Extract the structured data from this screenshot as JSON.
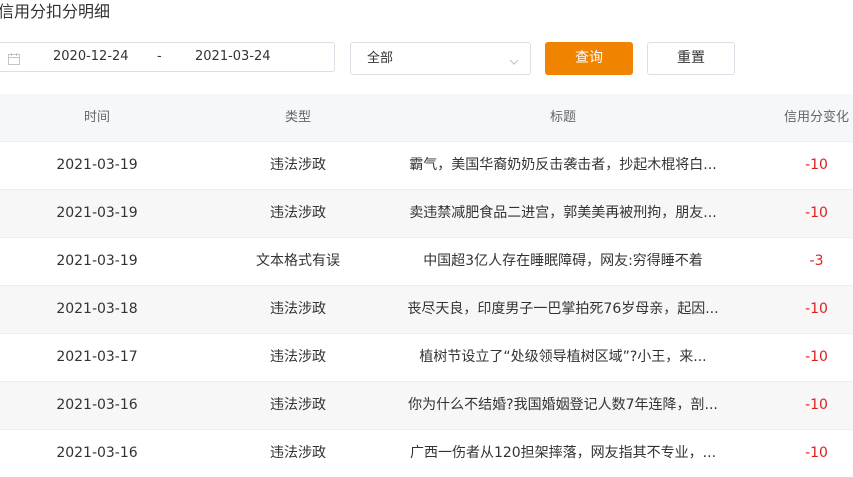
{
  "page": {
    "title": "信用分扣分明细"
  },
  "filters": {
    "date_start": "2020-12-24",
    "date_separator": "-",
    "date_end": "2021-03-24",
    "date_icon": "calendar-icon",
    "type_select_value": "全部",
    "type_select_icon": "chevron-down-icon",
    "query_button": "查询",
    "reset_button": "重置"
  },
  "colors": {
    "accent": "#f08300",
    "negative": "#e02020",
    "header_bg": "#f5f7fa"
  },
  "table": {
    "headers": {
      "time": "时间",
      "type": "类型",
      "title": "标题",
      "change": "信用分变化"
    },
    "rows": [
      {
        "time": "2021-03-19",
        "type": "违法涉政",
        "title": "霸气，美国华裔奶奶反击袭击者，抄起木棍将白...",
        "change": "-10"
      },
      {
        "time": "2021-03-19",
        "type": "违法涉政",
        "title": "卖违禁减肥食品二进宫，郭美美再被刑拘，朋友...",
        "change": "-10"
      },
      {
        "time": "2021-03-19",
        "type": "文本格式有误",
        "title": "中国超3亿人存在睡眠障碍，网友:穷得睡不着",
        "change": "-3"
      },
      {
        "time": "2021-03-18",
        "type": "违法涉政",
        "title": "丧尽天良，印度男子一巴掌拍死76岁母亲，起因...",
        "change": "-10"
      },
      {
        "time": "2021-03-17",
        "type": "违法涉政",
        "title": "植树节设立了“处级领导植树区域”?小王，来...",
        "change": "-10"
      },
      {
        "time": "2021-03-16",
        "type": "违法涉政",
        "title": "你为什么不结婚?我国婚姻登记人数7年连降，剖...",
        "change": "-10"
      },
      {
        "time": "2021-03-16",
        "type": "违法涉政",
        "title": "广西一伤者从120担架摔落，网友指其不专业，...",
        "change": "-10"
      }
    ]
  }
}
